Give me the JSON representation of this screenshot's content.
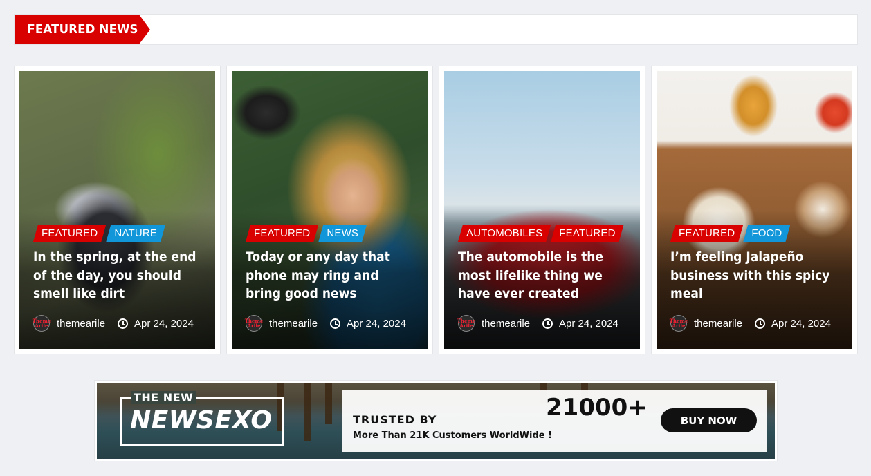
{
  "section": {
    "title": "FEATURED NEWS"
  },
  "cards": [
    {
      "categories": [
        "FEATURED",
        "NATURE"
      ],
      "title": "In the spring, at the end of the day, you should smell like dirt",
      "author": "themearile",
      "date": "Apr 24, 2024",
      "image": "bird-on-branch"
    },
    {
      "categories": [
        "FEATURED",
        "NEWS"
      ],
      "title": "Today or any day that phone may ring and bring good news",
      "author": "themearile",
      "date": "Apr 24, 2024",
      "image": "news-reporter"
    },
    {
      "categories": [
        "AUTOMOBILES",
        "FEATURED"
      ],
      "title": "The automobile is the most lifelike thing we have ever created",
      "author": "themearile",
      "date": "Apr 24, 2024",
      "image": "red-convertible"
    },
    {
      "categories": [
        "FEATURED",
        "FOOD"
      ],
      "title": "I’m feeling Jalapeño business with this spicy meal",
      "author": "themearile",
      "date": "Apr 24, 2024",
      "image": "food-bowls"
    }
  ],
  "avatar": {
    "line1": "Theme",
    "line2": "Arile"
  },
  "colors": {
    "accent_red": "#d90000",
    "accent_blue": "#1196d9"
  },
  "banner": {
    "logo_small": "THE NEW",
    "logo_big": "NEWSEXO",
    "trusted_by": "TRUSTED BY",
    "trusted_sub": "More Than 21K Customers WorldWide !",
    "count": "21000+",
    "button": "BUY NOW"
  }
}
